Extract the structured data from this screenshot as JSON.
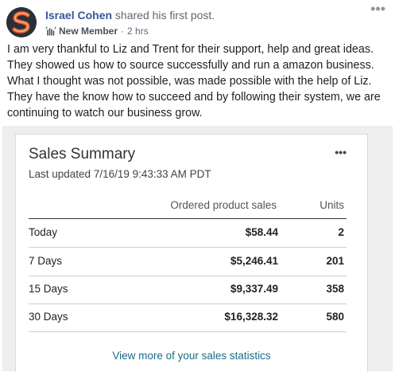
{
  "post": {
    "author": "Israel Cohen",
    "action": "shared his first post.",
    "badge": "New Member",
    "separator": "·",
    "time": "2 hrs",
    "more": "•••",
    "text": "I am very thankful to Liz and Trent for their support, help and great ideas. They showed us how to source successfully and run a amazon business. What I thought was not possible, was made possible with the help of Liz. They have the know how to succeed and by following their system, we are continuing to watch our business grow."
  },
  "card": {
    "title": "Sales Summary",
    "updated": "Last updated 7/16/19 9:43:33 AM PDT",
    "more": "•••",
    "headers": {
      "product_sales": "Ordered product sales",
      "units": "Units"
    },
    "rows": [
      {
        "period": "Today",
        "sales": "$58.44",
        "units": "2"
      },
      {
        "period": "7 Days",
        "sales": "$5,246.41",
        "units": "201"
      },
      {
        "period": "15 Days",
        "sales": "$9,337.49",
        "units": "358"
      },
      {
        "period": "30 Days",
        "sales": "$16,328.32",
        "units": "580"
      }
    ],
    "view_more": "View more of your sales statistics"
  },
  "colors": {
    "author_link": "#365899",
    "card_link": "#1a6c86",
    "avatar_accent": "#e8632c"
  }
}
